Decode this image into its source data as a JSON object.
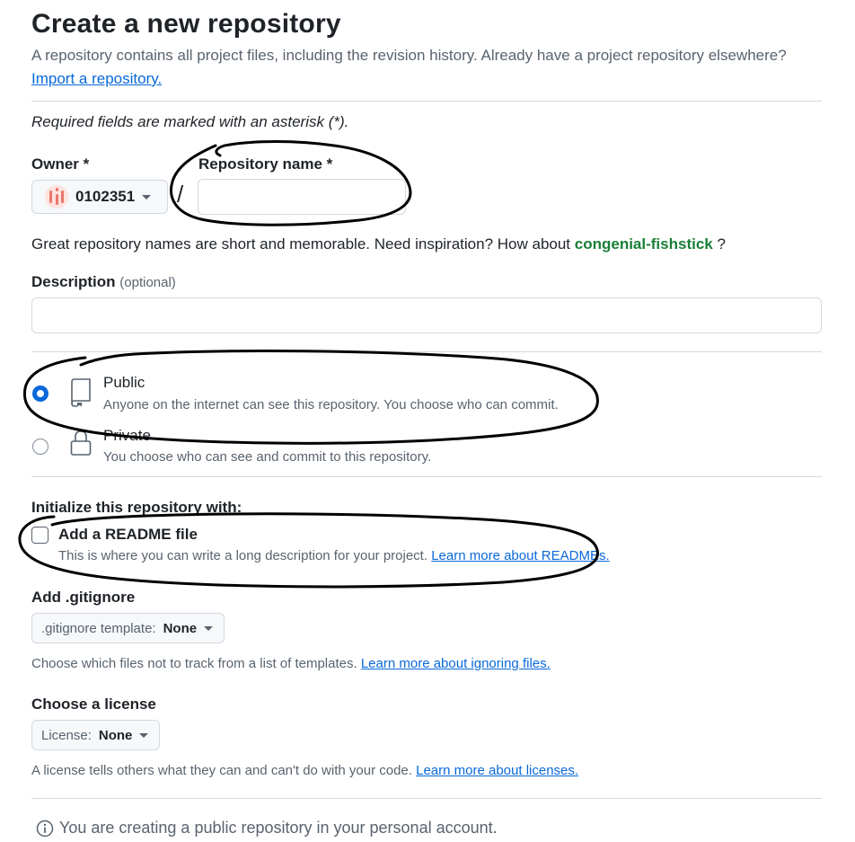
{
  "header": {
    "title": "Create a new repository",
    "subtitle": "A repository contains all project files, including the revision history. Already have a project repository elsewhere?",
    "import_link": "Import a repository."
  },
  "required_note": "Required fields are marked with an asterisk (*).",
  "owner": {
    "label": "Owner *",
    "value": "0102351",
    "icon": "avatar-identicon"
  },
  "separator": "/",
  "repo_name": {
    "label": "Repository name *",
    "value": "",
    "placeholder": ""
  },
  "name_hint": {
    "prefix": "Great repository names are short and memorable. Need inspiration? How about",
    "suggestion": "congenial-fishstick",
    "suffix": " ?"
  },
  "description": {
    "label": "Description",
    "optional": "(optional)",
    "value": ""
  },
  "visibility": {
    "options": [
      {
        "title": "Public",
        "description": "Anyone on the internet can see this repository. You choose who can commit.",
        "selected": true,
        "icon": "repo-icon"
      },
      {
        "title": "Private",
        "description": "You choose who can see and commit to this repository.",
        "selected": false,
        "icon": "lock-icon"
      }
    ]
  },
  "initialize": {
    "heading": "Initialize this repository with:",
    "readme": {
      "title": "Add a README file",
      "description": "This is where you can write a long description for your project.",
      "link": "Learn more about READMEs.",
      "checked": false
    }
  },
  "gitignore": {
    "heading": "Add .gitignore",
    "select_prefix": ".gitignore template:",
    "select_value": "None",
    "note": "Choose which files not to track from a list of templates.",
    "link": "Learn more about ignoring files."
  },
  "license": {
    "heading": "Choose a license",
    "select_prefix": "License:",
    "select_value": "None",
    "note": "A license tells others what they can and can't do with your code.",
    "link": "Learn more about licenses."
  },
  "footer_info": "You are creating a public repository in your personal account.",
  "colors": {
    "accent": "#0969da",
    "suggestion": "#1a7f37",
    "muted": "#59636e",
    "border": "#d1d9e0"
  }
}
